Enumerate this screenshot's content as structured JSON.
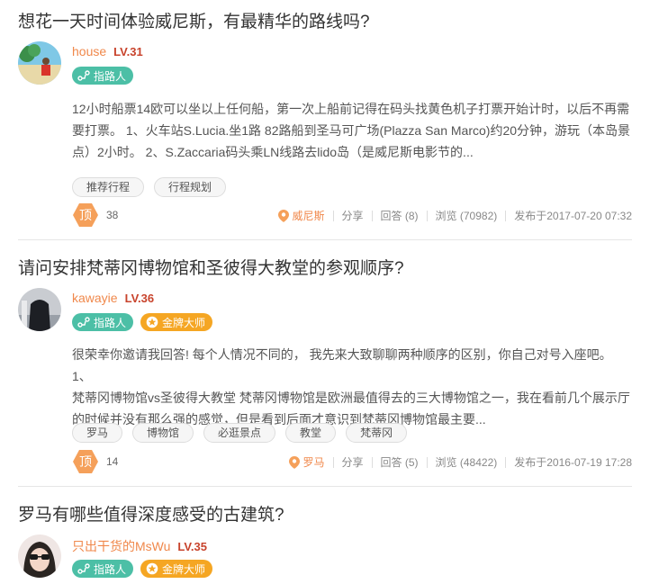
{
  "questions": [
    {
      "title": "想花一天时间体验威尼斯，有最精华的路线吗?",
      "author": {
        "name": "house",
        "level": "LV.31"
      },
      "badges": [
        "指路人"
      ],
      "excerpt_lines": [
        "12小时船票14欧可以坐以上任何船，第一次上船前记得在码头找黄色机子打票开始计时，以后不再需",
        "要打票。 1、火车站S.Lucia.坐1路 82路船到圣马可广场(Plazza San Marco)约20分钟，游玩（本岛景",
        "点）2小时。 2、S.Zaccaria码头乘LN线路去lido岛（是威尼斯电影节的..."
      ],
      "tags": [
        "推荐行程",
        "行程规划"
      ],
      "ding_label": "顶",
      "ding_count": "38",
      "location": "威尼斯",
      "share": "分享",
      "answers": "回答 (8)",
      "views": "浏览 (70982)",
      "published": "发布于2017-07-20 07:32"
    },
    {
      "title": "请问安排梵蒂冈博物馆和圣彼得大教堂的参观顺序?",
      "author": {
        "name": "kawayie",
        "level": "LV.36"
      },
      "badges": [
        "指路人",
        "金牌大师"
      ],
      "excerpt_lines": [
        "很荣幸你邀请我回答! 每个人情况不同的， 我先来大致聊聊两种顺序的区别，你自己对号入座吧。 1、",
        "梵蒂冈博物馆vs圣彼得大教堂 梵蒂冈博物馆是欧洲最值得去的三大博物馆之一，我在看前几个展示厅",
        "的时候并没有那么强的感觉，但是看到后面才意识到梵蒂冈博物馆最主要..."
      ],
      "tags": [
        "罗马",
        "博物馆",
        "必逛景点",
        "教堂",
        "梵蒂冈"
      ],
      "ding_label": "顶",
      "ding_count": "14",
      "location": "罗马",
      "share": "分享",
      "answers": "回答 (5)",
      "views": "浏览 (48422)",
      "published": "发布于2016-07-19 17:28"
    },
    {
      "title": "罗马有哪些值得深度感受的古建筑?",
      "author": {
        "name": "只出干货的MsWu",
        "level": "LV.35"
      },
      "badges": [
        "指路人",
        "金牌大师"
      ]
    }
  ],
  "colors": {
    "accent": "#f0884b",
    "guide_badge": "#4cbfa6",
    "gold_badge": "#f5a623",
    "level": "#c8432c"
  }
}
